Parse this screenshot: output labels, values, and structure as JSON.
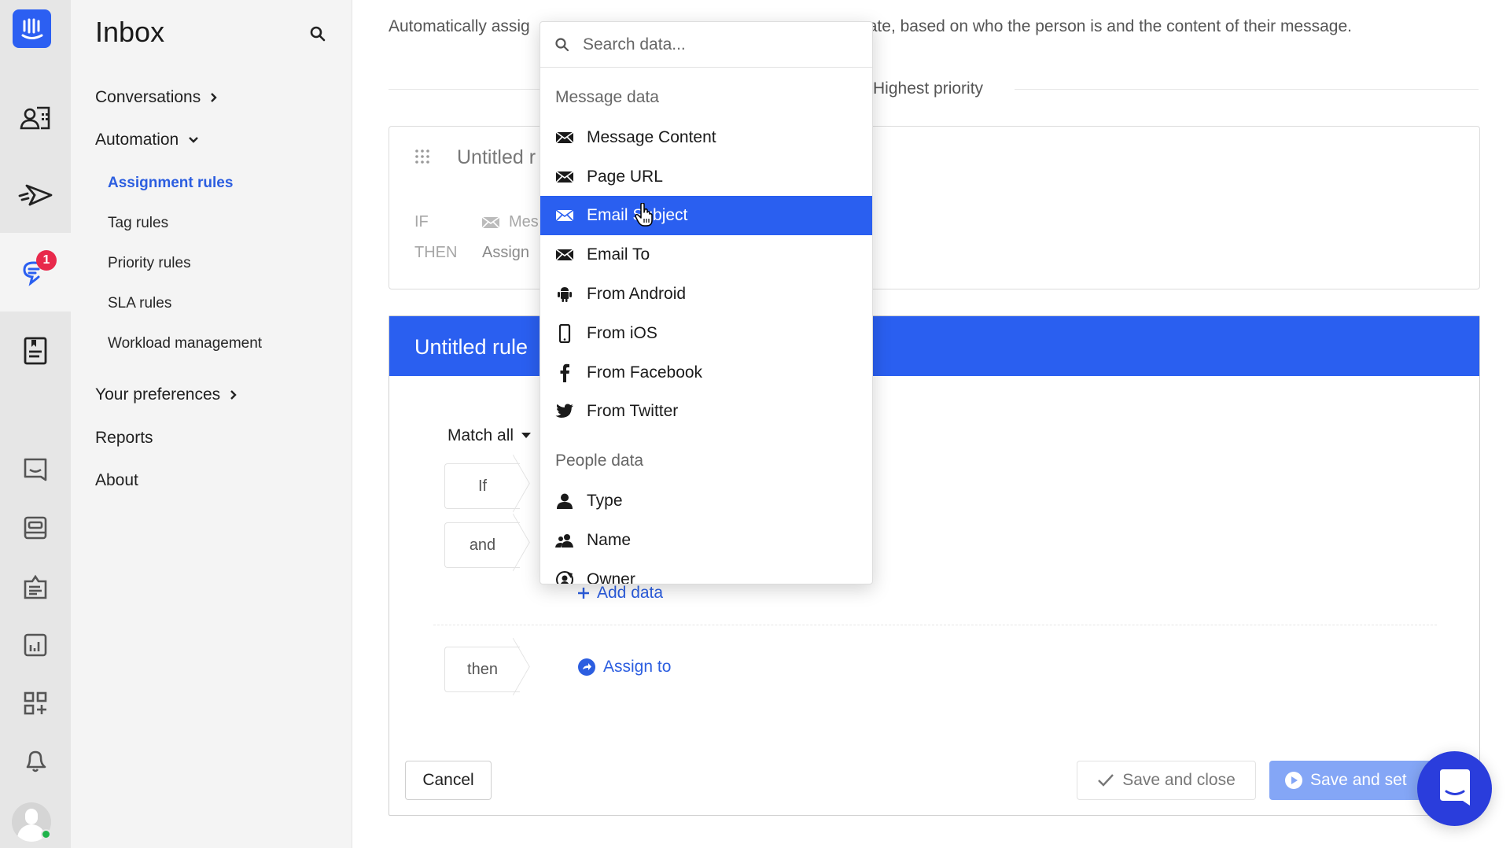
{
  "rail": {
    "items": [
      {
        "name": "logo",
        "icon": "intercom-logo-icon"
      },
      {
        "name": "contacts",
        "icon": "contacts-icon"
      },
      {
        "name": "outbound",
        "icon": "send-icon"
      },
      {
        "name": "inbox",
        "icon": "inbox-chat-icon",
        "badge": "1",
        "active": true
      },
      {
        "name": "articles",
        "icon": "articles-icon"
      },
      {
        "name": "messenger",
        "icon": "messenger-icon"
      },
      {
        "name": "knowledge",
        "icon": "book-icon"
      },
      {
        "name": "operator",
        "icon": "operator-icon"
      },
      {
        "name": "reports",
        "icon": "chart-icon"
      },
      {
        "name": "apps",
        "icon": "apps-icon"
      },
      {
        "name": "notifications",
        "icon": "bell-icon"
      }
    ]
  },
  "nav": {
    "title": "Inbox",
    "conversations": "Conversations",
    "automation": "Automation",
    "sub_items": [
      "Assignment rules",
      "Tag rules",
      "Priority rules",
      "SLA rules",
      "Workload management"
    ],
    "active_sub": "Assignment rules",
    "your_preferences": "Your preferences",
    "reports": "Reports",
    "about": "About"
  },
  "main": {
    "description_left": "Automatically assig",
    "description_right": "ate, based on who the person is and the content of their message.",
    "priority_label": "Highest priority",
    "rule_card": {
      "title": "Untitled r",
      "if_label": "IF",
      "if_value": "Mes",
      "then_label": "THEN",
      "then_value": "Assign"
    },
    "editor": {
      "title": "Untitled rule",
      "match": "Match all",
      "chips": [
        "If",
        "and",
        "then"
      ],
      "add_data": "Add data",
      "assign_to": "Assign to",
      "cancel": "Cancel",
      "save_close": "Save and close",
      "save_set": "Save and set"
    }
  },
  "dropdown": {
    "search_placeholder": "Search data...",
    "groups": [
      {
        "label": "Message data",
        "items": [
          {
            "label": "Message Content",
            "icon": "envelope-icon"
          },
          {
            "label": "Page URL",
            "icon": "envelope-icon"
          },
          {
            "label": "Email Subject",
            "icon": "envelope-icon",
            "active": true
          },
          {
            "label": "Email To",
            "icon": "envelope-icon"
          },
          {
            "label": "From Android",
            "icon": "android-icon"
          },
          {
            "label": "From iOS",
            "icon": "phone-icon"
          },
          {
            "label": "From Facebook",
            "icon": "facebook-icon"
          },
          {
            "label": "From Twitter",
            "icon": "twitter-icon"
          }
        ]
      },
      {
        "label": "People data",
        "items": [
          {
            "label": "Type",
            "icon": "person-icon"
          },
          {
            "label": "Name",
            "icon": "people-icon"
          },
          {
            "label": "Owner",
            "icon": "owner-icon"
          }
        ]
      }
    ]
  },
  "colors": {
    "accent": "#2a5ff0",
    "link": "#2c5ee0",
    "badge": "#e8294b",
    "messenger": "#2a3ddc",
    "save_set_disabled": "#84a6f6",
    "online": "#1fb34a"
  }
}
